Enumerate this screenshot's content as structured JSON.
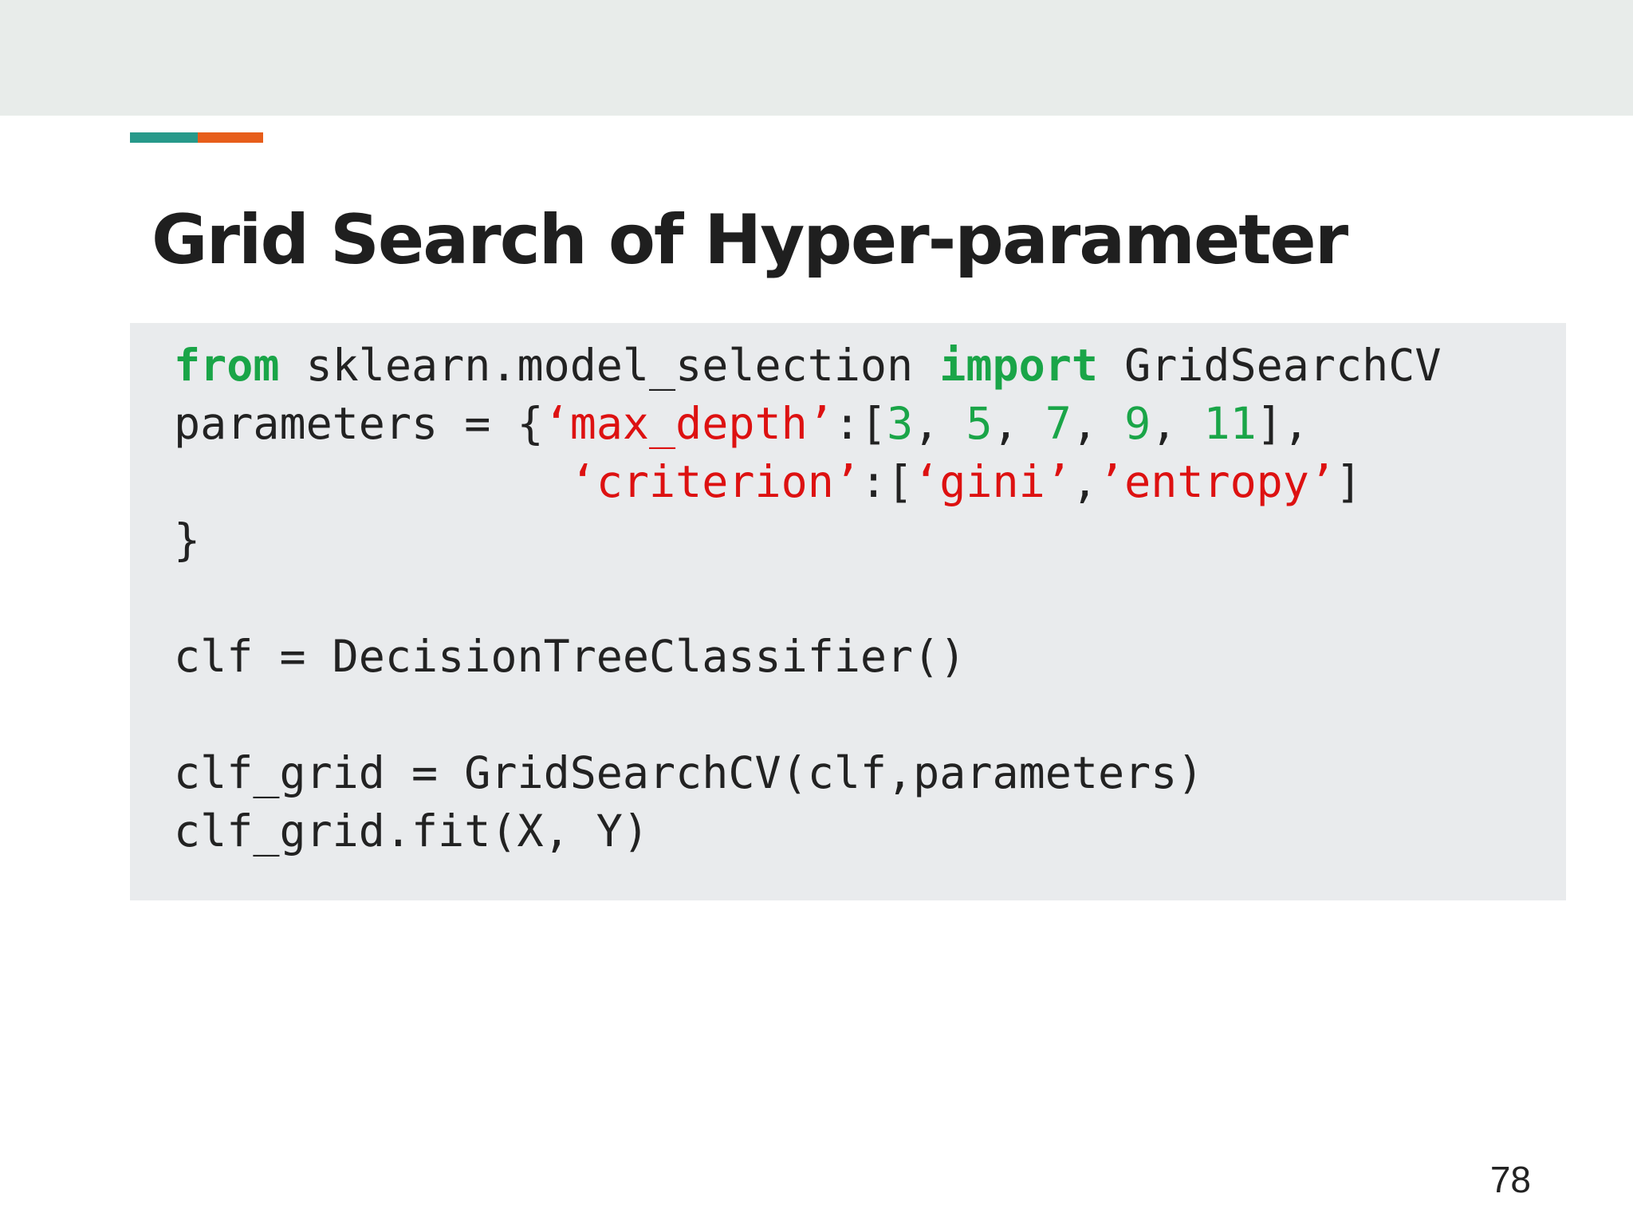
{
  "slide": {
    "title": "Grid Search of Hyper-parameter",
    "page_number": "78",
    "accent_colors": {
      "teal": "#27998a",
      "orange": "#e75d1a"
    }
  },
  "code": {
    "line1": {
      "kw_from": "from",
      "module": " sklearn.model_selection ",
      "kw_import": "import",
      "name": " GridSearchCV"
    },
    "line2": {
      "lhs": "parameters = {",
      "key": "‘max_depth’",
      "colon": ":[",
      "n1": "3",
      "sep1": ", ",
      "n2": "5",
      "sep2": ", ",
      "n3": "7",
      "sep3": ", ",
      "n4": "9",
      "sep4": ", ",
      "n5": "11",
      "end": "],"
    },
    "line3": {
      "indent": "               ",
      "key": "‘criterion’",
      "colon": ":[",
      "v1": "‘gini’",
      "comma": ",",
      "v2": "’entropy’",
      "end": "]"
    },
    "line4": "}",
    "line5": "clf = DecisionTreeClassifier()",
    "line6": "clf_grid = GridSearchCV(clf,parameters)",
    "line7": "clf_grid.fit(X, Y)"
  }
}
